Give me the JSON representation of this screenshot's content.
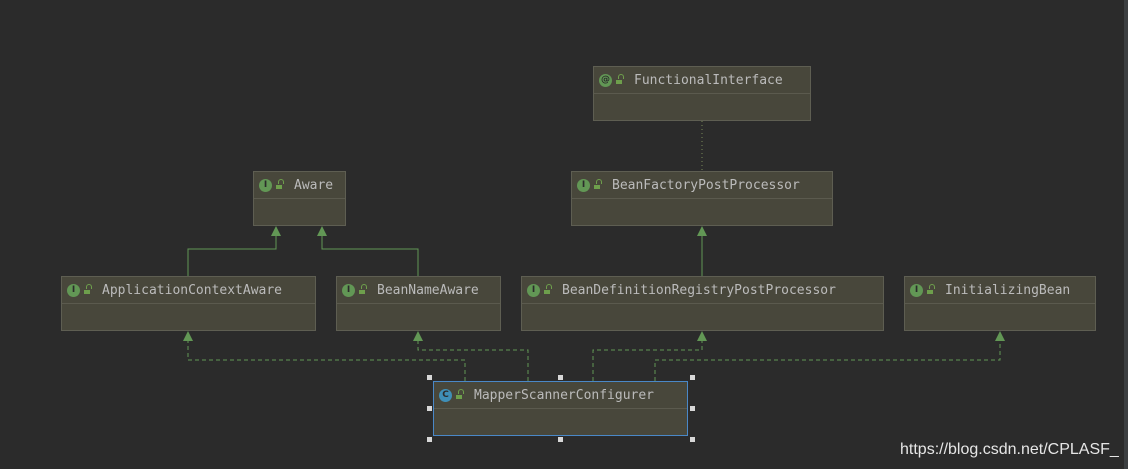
{
  "diagram": {
    "nodes": {
      "functional_interface": {
        "badge": "@",
        "name": "FunctionalInterface"
      },
      "aware": {
        "badge": "I",
        "name": "Aware"
      },
      "bean_factory_post_processor": {
        "badge": "I",
        "name": "BeanFactoryPostProcessor"
      },
      "application_context_aware": {
        "badge": "I",
        "name": "ApplicationContextAware"
      },
      "bean_name_aware": {
        "badge": "I",
        "name": "BeanNameAware"
      },
      "bean_definition_registry_post_processor": {
        "badge": "I",
        "name": "BeanDefinitionRegistryPostProcessor"
      },
      "initializing_bean": {
        "badge": "I",
        "name": "InitializingBean"
      },
      "mapper_scanner_configurer": {
        "badge": "C",
        "name": "MapperScannerConfigurer"
      }
    },
    "edges": [
      {
        "from": "application_context_aware",
        "to": "aware",
        "kind": "extends"
      },
      {
        "from": "bean_name_aware",
        "to": "aware",
        "kind": "extends"
      },
      {
        "from": "bean_definition_registry_post_processor",
        "to": "bean_factory_post_processor",
        "kind": "extends"
      },
      {
        "from": "bean_factory_post_processor",
        "to": "functional_interface",
        "kind": "annotated"
      },
      {
        "from": "mapper_scanner_configurer",
        "to": "application_context_aware",
        "kind": "implements"
      },
      {
        "from": "mapper_scanner_configurer",
        "to": "bean_name_aware",
        "kind": "implements"
      },
      {
        "from": "mapper_scanner_configurer",
        "to": "bean_definition_registry_post_processor",
        "kind": "implements"
      },
      {
        "from": "mapper_scanner_configurer",
        "to": "initializing_bean",
        "kind": "implements"
      }
    ],
    "colors": {
      "background": "#2b2b2b",
      "node_fill": "#48473b",
      "interface_badge": "#629755",
      "class_badge": "#3f8fb7",
      "edge": "#629755",
      "selection": "#4a88c7"
    }
  },
  "watermark": "https://blog.csdn.net/CPLASF_"
}
